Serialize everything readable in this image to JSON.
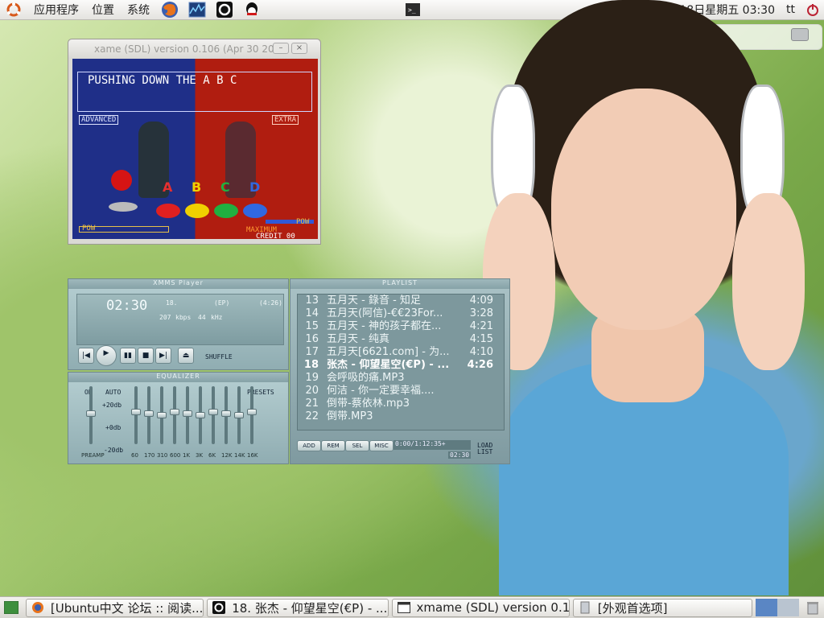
{
  "top_panel": {
    "menus": [
      "应用程序",
      "位置",
      "系统"
    ],
    "launchers": [
      "firefox-icon",
      "system-monitor-icon",
      "xmms-icon",
      "qq-icon"
    ],
    "clock": "4月18日星期五 03:30",
    "user": "tt"
  },
  "xmame": {
    "title": "xame (SDL) version 0.106 (Apr 30 20",
    "game_title": "PUSHING DOWN THE A B C",
    "tag_left": "ADVANCED",
    "tag_right": "EXTRA",
    "buttons": [
      "A",
      "B",
      "C",
      "D"
    ],
    "pow_left": "POW",
    "pow_right": "POW",
    "maximum": "MAXIMUM",
    "credit": "CREDIT 00"
  },
  "xmms": {
    "player_title": "XMMS Player",
    "time": "02:30",
    "track_no": "18.",
    "track_tag": "(EP)",
    "track_len": "(4:26)",
    "kbps_value": "207",
    "kbps_label": "kbps",
    "khz_value": "44",
    "khz_label": "kHz",
    "shuffle": "SHUFFLE",
    "eq_title": "EQUALIZER",
    "eq_on": "ON",
    "eq_auto": "AUTO",
    "eq_presets": "PRESETS",
    "eq_preamp": "PREAMP",
    "eq_db_top": "+20db",
    "eq_db_mid": "+0db",
    "eq_db_bot": "-20db",
    "eq_bands": [
      "60",
      "170",
      "310",
      "600",
      "1K",
      "3K",
      "6K",
      "12K",
      "14K",
      "16K"
    ],
    "playlist_title": "PLAYLIST",
    "playlist": [
      {
        "num": "13",
        "title": "五月天 - 錄音 - 知足",
        "time": "4:09"
      },
      {
        "num": "14",
        "title": "五月天(阿信)-€€23For...",
        "time": "3:28"
      },
      {
        "num": "15",
        "title": "五月天 - 神的孩子都在...",
        "time": "4:21"
      },
      {
        "num": "16",
        "title": "五月天 - 纯真",
        "time": "4:15"
      },
      {
        "num": "17",
        "title": "五月天[6621.com] - 为...",
        "time": "4:10"
      },
      {
        "num": "18",
        "title": "张杰 - 仰望星空(€P) - ...",
        "time": "4:26"
      },
      {
        "num": "19",
        "title": "会呼吸的痛.MP3",
        "time": ""
      },
      {
        "num": "20",
        "title": "何洁 - 你一定要幸福....",
        "time": ""
      },
      {
        "num": "21",
        "title": "倒带-蔡依林.mp3",
        "time": ""
      },
      {
        "num": "22",
        "title": "倒带.MP3",
        "time": ""
      }
    ],
    "pl_buttons": [
      "ADD",
      "REM",
      "SEL",
      "MISC"
    ],
    "pl_info": "0:00/1:12:35+",
    "pl_time": "02:30",
    "pl_load": "LOAD",
    "pl_list": "LIST"
  },
  "taskbar": {
    "tasks": [
      "[Ubuntu中文 论坛 :: 阅读...",
      "18. 张杰 - 仰望星空(€P) - ...",
      "xmame (SDL) version 0.1...",
      "[外观首选项]"
    ]
  }
}
